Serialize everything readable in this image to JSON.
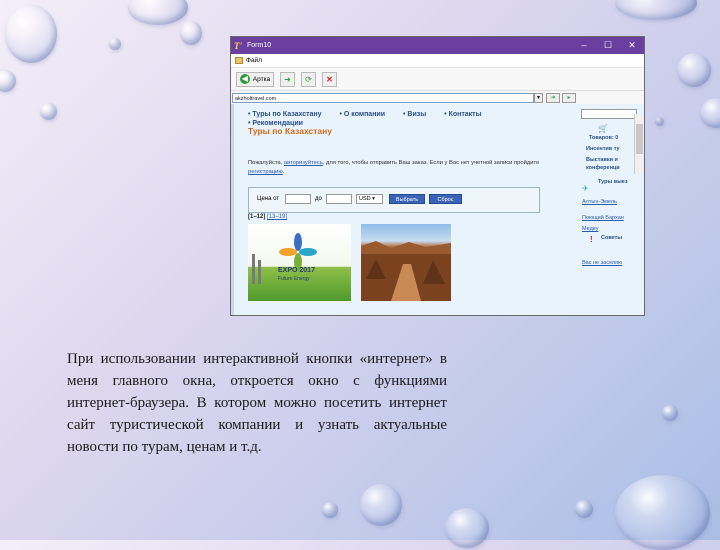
{
  "window": {
    "title": "Form10",
    "app_icon": "Т'",
    "controls": {
      "minimize": "–",
      "maximize": "☐",
      "close": "✕"
    }
  },
  "menu": {
    "file_label": "Файл"
  },
  "toolbar": {
    "back_label": "Артка"
  },
  "address": {
    "url": "akzholtravel.com"
  },
  "site": {
    "nav_line1": [
      "Туры по Казахстану",
      "О компании",
      "Визы",
      "Контакты"
    ],
    "nav_line2": [
      "Рекомендации"
    ],
    "heading": "Туры по Казахстану",
    "para_pre": "Пожалуйста, ",
    "para_link1": "авторизуйтесь",
    "para_mid": ", для того, чтобы отправить Ваш заказ. Если у Вас нет учетной записи пройдите ",
    "para_link2": "регистрацию",
    "para_post": ".",
    "price_from": "Цена от",
    "price_to": "до",
    "currency": "USD",
    "btn_select": "Выбрать",
    "btn_reset": "Сброс",
    "pager_current": "[1–12]",
    "pager_link": "[13–19]",
    "img1_line1": "EXPO 2017",
    "img1_line2": "Future Energy",
    "right": {
      "goods": "Товаров: 0",
      "promo1_a": "Инсентив ту",
      "promo1_b": "Выставки и",
      "promo1_c": "конференци",
      "tours_out": "Туры выез",
      "link1": "Алтын-Эмель",
      "link2": "Поющий Бархан",
      "link3": "Медеу",
      "advice": "Советы",
      "faq": "Вас не заселяю"
    }
  },
  "caption": "При использовании интерактивной кнопки «интернет» в меня главного окна, откроется окно с функциями интернет-браузера. В котором можно посетить интернет сайт туристической компании и узнать актуальные новости по турам, ценам и т.д.",
  "colors": {
    "titlebar": "#6b3fa0",
    "site_bg": "#e9f3fb",
    "heading": "#d2691e",
    "link": "#2a5db0"
  }
}
